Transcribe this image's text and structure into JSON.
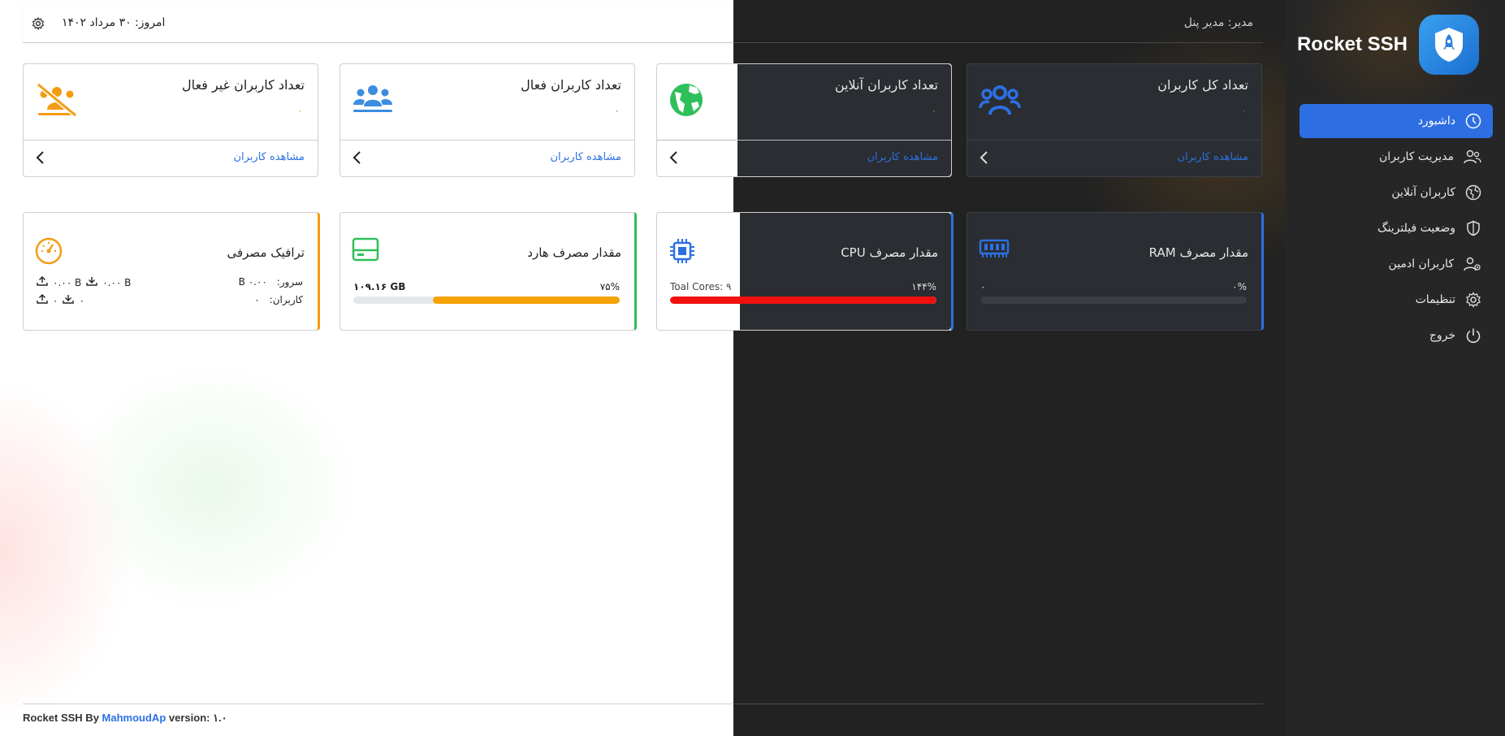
{
  "brand": {
    "name": "Rocket SSH"
  },
  "header": {
    "today": "امروز: ۳۰ مرداد ۱۴۰۲",
    "manager": "مدیر: مدیر پنل"
  },
  "sidebar": {
    "items": [
      {
        "label": "داشبورد",
        "icon": "dashboard-icon",
        "active": true
      },
      {
        "label": "مدیریت کاربران",
        "icon": "users-icon"
      },
      {
        "label": "کاربران آنلاین",
        "icon": "globe-icon"
      },
      {
        "label": "وضعیت فیلترینگ",
        "icon": "shield-icon"
      },
      {
        "label": "کاربران ادمین",
        "icon": "admin-users-icon"
      },
      {
        "label": "تنظیمات",
        "icon": "gear-icon"
      },
      {
        "label": "خروج",
        "icon": "power-icon"
      }
    ]
  },
  "stats": [
    {
      "title": "تعداد کل کاربران",
      "value": "۰",
      "link": "مشاهده کاربران",
      "color": "#2d6fe3"
    },
    {
      "title": "تعداد کاربران آنلاین",
      "value": "۰",
      "link": "مشاهده کاربران",
      "color": "#2fbf5a"
    },
    {
      "title": "تعداد کاربران فعال",
      "value": "۰",
      "link": "مشاهده کاربران",
      "color": "#3b8de0"
    },
    {
      "title": "تعداد کاربران غیر فعال",
      "value": "۰",
      "link": "مشاهده کاربران",
      "color": "#f39c12"
    }
  ],
  "resources": {
    "ram": {
      "title": "مقدار مصرف RAM",
      "percent": "۰%",
      "amount": "۰",
      "fill": 0,
      "color": "#2d6fe3"
    },
    "cpu": {
      "title": "مقدار مصرف CPU",
      "percent": "۱۴۴%",
      "amount": "Toal Cores: ۹",
      "fill": 1,
      "color": "#f01010"
    },
    "disk": {
      "title": "مقدار مصرف هارد",
      "percent": "۷۵%",
      "amount": "۱۰۹.۱۶ GB",
      "fill": 0.7,
      "color": "#f5a300"
    },
    "traffic": {
      "title": "ترافیک مصرفی",
      "server_label": "سرور:",
      "server_value": "B ۰.۰۰",
      "users_label": "کاربران:",
      "users_value": "۰",
      "server_up": "۰.۰۰ B",
      "server_down": "۰.۰۰ B",
      "users_up": "۰",
      "users_down": "۰"
    }
  },
  "footer": {
    "prefix": "Rocket SSH By",
    "author": "MahmoudAp",
    "version": "version: ۱.۰"
  }
}
